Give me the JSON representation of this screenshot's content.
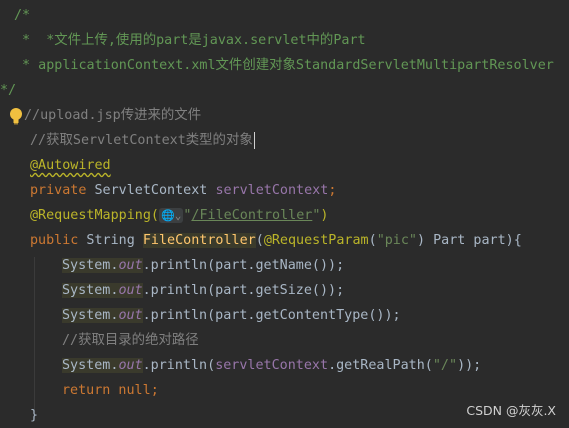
{
  "lines": {
    "l1": "/*",
    "l2": " *  *文件上传,使用的part是javax.servlet中的Part",
    "l3": " * applicationContext.xml文件创建对象StandardServletMultipartResolver",
    "l4": "*/",
    "l5": "//upload.jsp传进来的文件",
    "l6": "//获取ServletContext类型的对象",
    "l7_ann": "@Autowired",
    "l8_kw": "private",
    "l8_type": " ServletContext ",
    "l8_field": "servletContext",
    "l8_semi": ";",
    "l9_ann": "@RequestMapping(",
    "l9_inlay": "🌐⌄",
    "l9_q1": "\"",
    "l9_path": "/FileController",
    "l9_q2": "\"",
    "l9_close": ")",
    "l10_kw": "public",
    "l10_type": " String ",
    "l10_method": "FileController",
    "l10_p1": "(",
    "l10_ann": "@RequestParam",
    "l10_p2": "(",
    "l10_str": "\"pic\"",
    "l10_p3": ") Part part){",
    "sys": "System.",
    "out": "out",
    "l11_rest": ".println(part.getName());",
    "l12_rest": ".println(part.getSize());",
    "l13_rest": ".println(part.getContentType());",
    "l14": "//获取目录的绝对路径",
    "l15_a": ".println(",
    "l15_field": "servletContext",
    "l15_b": ".getRealPath(",
    "l15_str": "\"/\"",
    "l15_c": "));",
    "l16_kw": "return null",
    "l16_semi": ";",
    "l17": "}"
  },
  "watermark": "CSDN @灰灰.X",
  "icons": {
    "bulb": "lightbulb-icon"
  },
  "colors": {
    "background": "#2b2b2b",
    "keyword": "#cc7832",
    "annotation": "#bbb529",
    "string": "#6a8759",
    "field": "#9876aa",
    "method": "#ffc66d",
    "comment": "#808080",
    "doc_comment": "#629755"
  }
}
